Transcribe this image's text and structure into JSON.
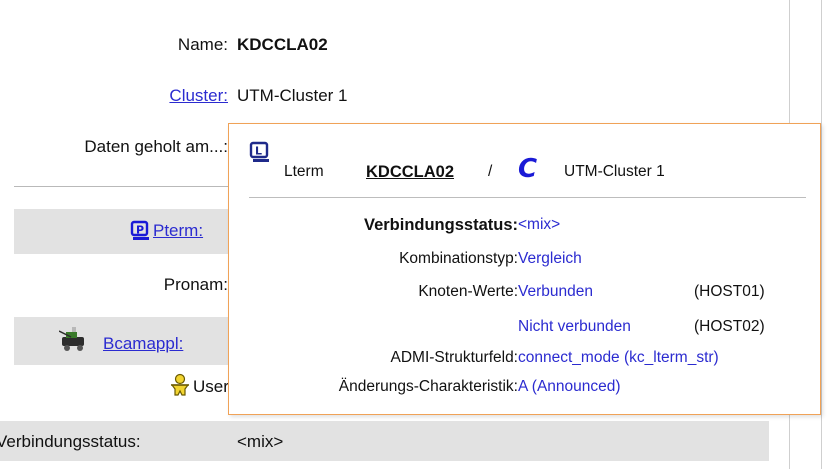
{
  "main": {
    "name_label": "Name:",
    "name_value": "KDCCLA02",
    "cluster_label": "Cluster:",
    "cluster_value": "UTM-Cluster 1",
    "daten_label": "Daten geholt am...:",
    "pterm_label": "Pterm:",
    "pronam_label": "Pronam:",
    "bcamappl_label": "Bcamappl:",
    "user_label": "User:",
    "verbindungsstatus_label": "Verbindungsstatus:",
    "verbindungsstatus_value": "<mix>"
  },
  "popup": {
    "type_label": "Lterm",
    "name": "KDCCLA02",
    "slash": "/",
    "cluster_icon_glyph": "C",
    "cluster_name": "UTM-Cluster 1",
    "rows": {
      "verbindungsstatus": {
        "label": "Verbindungsstatus:",
        "value": "<mix>"
      },
      "kombinationstyp": {
        "label": "Kombinationstyp:",
        "value": "Vergleich"
      },
      "knoten_werte": {
        "label": "Knoten-Werte:",
        "values": [
          {
            "status": "Verbunden",
            "host": "(HOST01)"
          },
          {
            "status": "Nicht verbunden",
            "host": "(HOST02)"
          }
        ]
      },
      "admi_strukturfeld": {
        "label": "ADMI-Strukturfeld:",
        "value": "connect_mode (kc_lterm_str)"
      },
      "aenderungs_charakteristik": {
        "label": "Änderungs-Charakteristik:",
        "value": "A (Announced)"
      }
    }
  },
  "colors": {
    "link": "#2b2bd0",
    "popup_border": "#f0a257",
    "band": "#e2e2e2",
    "cluster_icon": "#1a1ad6"
  },
  "icons": [
    "lterm-icon",
    "cluster-c-icon",
    "pterm-icon",
    "bcamappl-icon",
    "user-icon"
  ]
}
